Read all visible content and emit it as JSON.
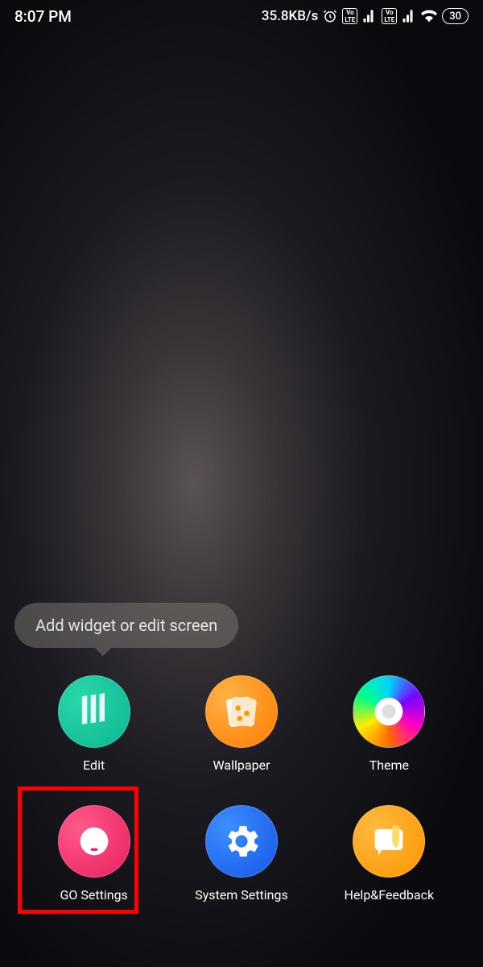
{
  "status": {
    "time": "8:07 PM",
    "network_speed": "35.8KB/s",
    "battery": "30"
  },
  "tooltip": {
    "text": "Add widget or edit screen"
  },
  "icons": {
    "edit": "Edit",
    "wallpaper": "Wallpaper",
    "theme": "Theme",
    "go_settings": "GO Settings",
    "system_settings": "System Settings",
    "help_feedback": "Help&Feedback"
  }
}
